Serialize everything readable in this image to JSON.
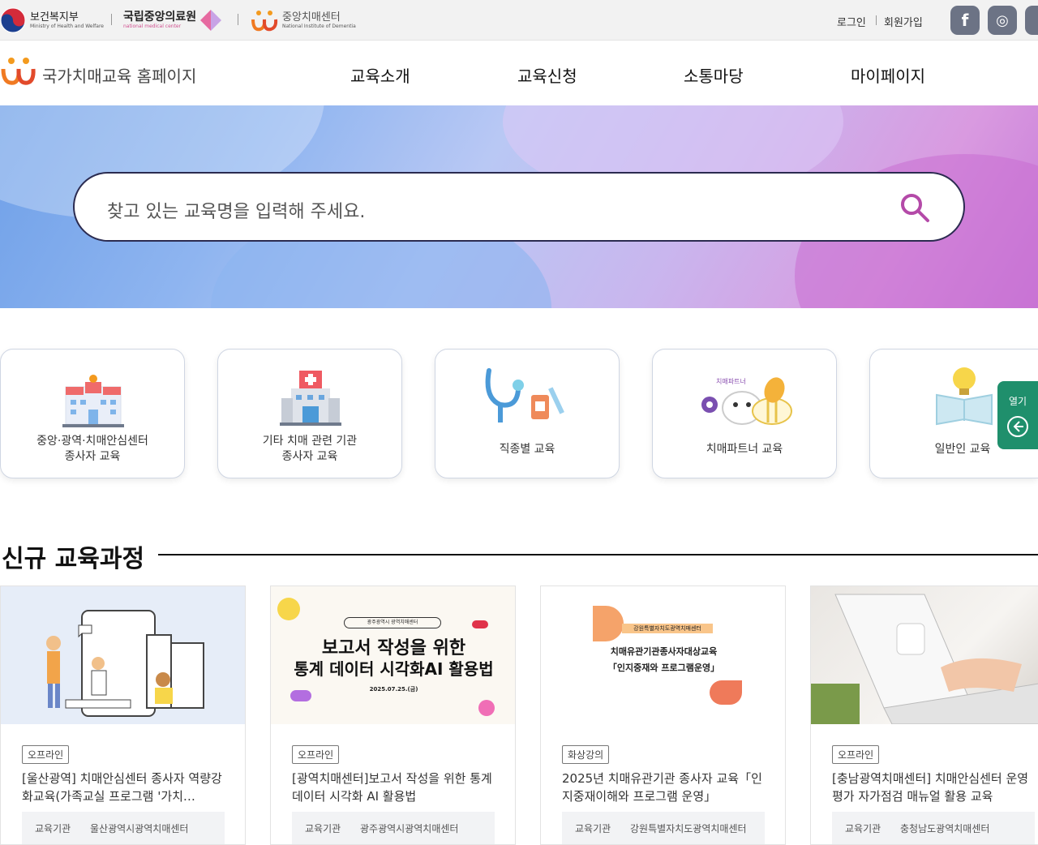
{
  "topbar": {
    "ministry": {
      "ko": "보건복지부",
      "en": "Ministry of Health and Welfare"
    },
    "nmc": {
      "ko": "국립중앙의료원",
      "en": "national medical center"
    },
    "nid": {
      "ko": "중앙치매센터",
      "en": "National Institute of Dementia"
    },
    "login": "로그인",
    "join": "회원가입",
    "sns": [
      {
        "icon": "facebook-icon",
        "glyph": "f"
      },
      {
        "icon": "instagram-icon",
        "glyph": "◎"
      }
    ]
  },
  "header": {
    "site_title": "국가치매교육 홈페이지",
    "nav": [
      "교육소개",
      "교육신청",
      "소통마당",
      "마이페이지"
    ]
  },
  "search": {
    "placeholder": "찾고 있는 교육명을 입력해 주세요."
  },
  "categories": [
    {
      "line1": "중앙·광역·치매안심센터",
      "line2": "종사자 교육",
      "icon": "hospital-building-icon"
    },
    {
      "line1": "기타 치매 관련 기관",
      "line2": "종사자 교육",
      "icon": "medical-building-icon"
    },
    {
      "line1": "직종별 교육",
      "line2": "",
      "icon": "stethoscope-icon"
    },
    {
      "line1": "치매파트너 교육",
      "line2": "",
      "icon": "bee-partner-icon",
      "inner_text": "치매파트너"
    },
    {
      "line1": "일반인 교육",
      "line2": "",
      "icon": "lightbulb-book-icon"
    }
  ],
  "side_tab": {
    "label": "열기"
  },
  "section": {
    "title": "신규 교육과정"
  },
  "courses": [
    {
      "badge": "오프라인",
      "title": "[울산광역] 치매안심센터 종사자 역량강화교육(가족교실 프로그램 '가치…",
      "inst_label": "교육기관",
      "inst": "울산광역시광역치매센터",
      "thumb": "people-illustration"
    },
    {
      "badge": "오프라인",
      "title": "[광역치매센터]보고서 작성을 위한 통계 데이터 시각화 AI 활용법",
      "inst_label": "교육기관",
      "inst": "광주광역시광역치매센터",
      "thumb_text": {
        "org": "광주광역시 광역치매센터",
        "line1": "보고서 작성을 위한",
        "line2": "통계 데이터 시각화AI 활용법",
        "date": "2025.07.25.(금)"
      }
    },
    {
      "badge": "화상강의",
      "title": "2025년 치매유관기관 종사자 교육「인지중재이해와 프로그램 운영」",
      "inst_label": "교육기관",
      "inst": "강원특별자치도광역치매센터",
      "thumb_text": {
        "org": "강원특별자치도광역치매센터",
        "line1": "치매유관기관종사자대상교육",
        "line2": "「인지중재와 프로그램운영」"
      }
    },
    {
      "badge": "오프라인",
      "title": "[충남광역치매센터] 치매안심센터 운영평가 자가점검 매뉴얼 활용 교육",
      "inst_label": "교육기관",
      "inst": "충청남도광역치매센터",
      "thumb": "laptop-photo"
    }
  ],
  "colors": {
    "accent_green": "#1f8f6c",
    "brand_orange": "#f07a22",
    "search_icon": "#b44aa8"
  }
}
